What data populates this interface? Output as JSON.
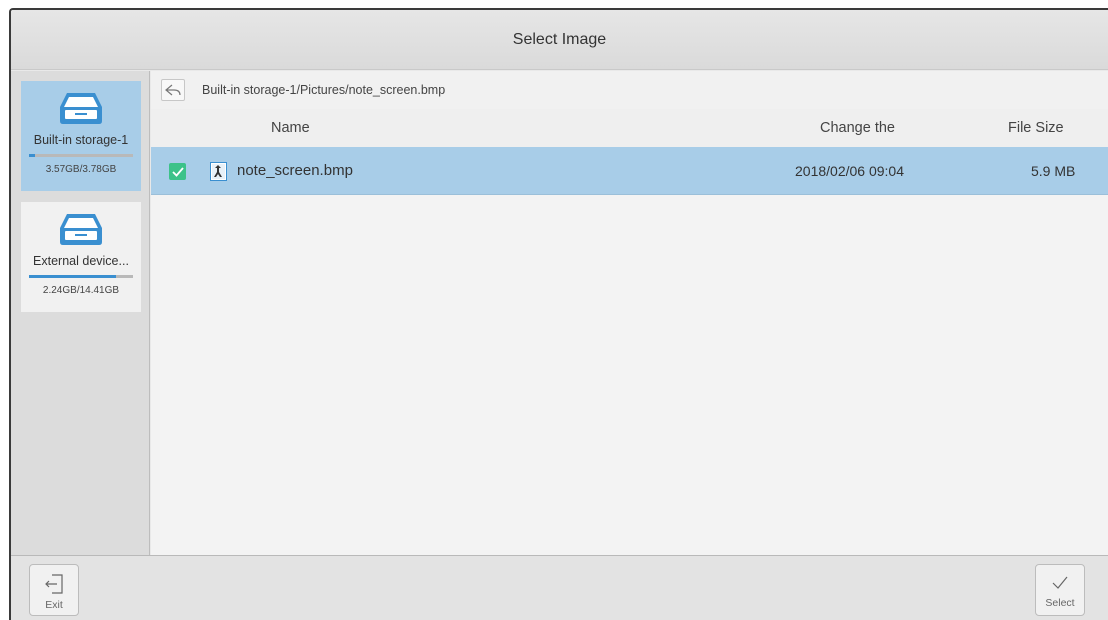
{
  "window": {
    "title": "Select Image"
  },
  "sidebar": {
    "items": [
      {
        "label": "Built-in storage-1",
        "size": "3.57GB/3.78GB",
        "usage_fraction": 0.06,
        "selected": true,
        "icon": "drive-icon"
      },
      {
        "label": "External device...",
        "size": "2.24GB/14.41GB",
        "usage_fraction": 0.84,
        "selected": false,
        "icon": "drive-icon"
      }
    ]
  },
  "pathbar": {
    "back_icon": "back-arrow-icon",
    "path": "Built-in storage-1/Pictures/note_screen.bmp"
  },
  "table": {
    "columns": {
      "name": "Name",
      "date": "Change the",
      "size": "File Size"
    },
    "rows": [
      {
        "checked": true,
        "icon": "image-file-icon",
        "name": "note_screen.bmp",
        "date": "2018/02/06 09:04",
        "size": "5.9 MB"
      }
    ]
  },
  "footer": {
    "exit_label": "Exit",
    "exit_icon": "exit-icon",
    "select_label": "Select",
    "select_icon": "checkmark-icon"
  },
  "colors": {
    "selection": "#a8cde8",
    "accent": "#3a8fd0",
    "check": "#3cc289"
  }
}
